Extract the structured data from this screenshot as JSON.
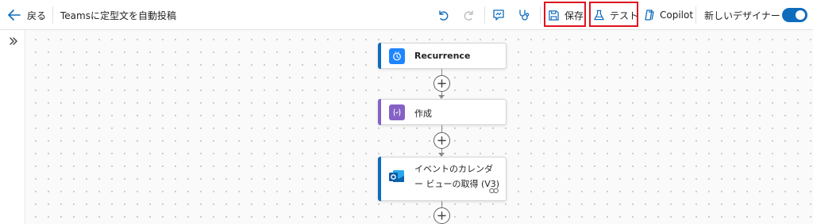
{
  "toolbar": {
    "back_label": "戻る",
    "flow_title": "Teamsに定型文を自動投稿",
    "save_label": "保存",
    "test_label": "テスト",
    "copilot_label": "Copilot",
    "new_designer_label": "新しいデザイナー",
    "new_designer_enabled": true,
    "highlight_color": "#e0121f",
    "accent_color": "#0f6cbd"
  },
  "flow": {
    "steps": [
      {
        "label": "Recurrence",
        "icon": "clock-icon",
        "accent": "#0f6cbd"
      },
      {
        "label": "作成",
        "icon": "compose-icon",
        "accent": "#8661c5"
      },
      {
        "label_line1": "イベントのカレンダ",
        "label_line2": "ー ビューの取得 (V3)",
        "icon": "outlook-icon",
        "accent": "#0f6cbd"
      }
    ]
  }
}
